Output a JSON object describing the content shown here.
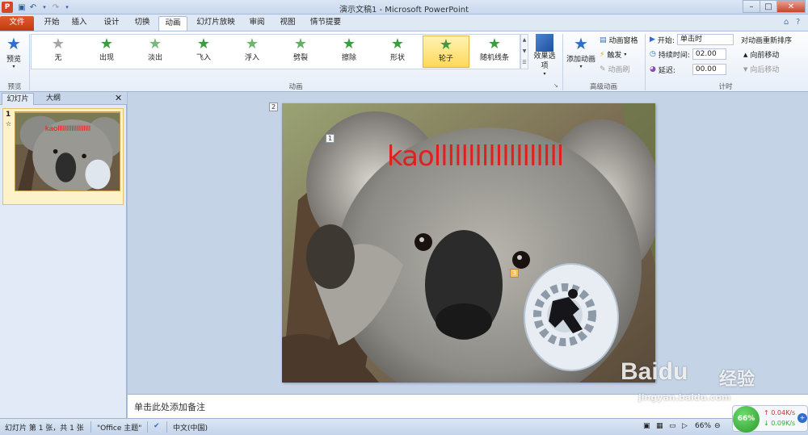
{
  "window": {
    "title": "演示文稿1 - Microsoft PowerPoint",
    "app_logo": "P"
  },
  "tabs": [
    "文件",
    "开始",
    "插入",
    "设计",
    "切换",
    "动画",
    "幻灯片放映",
    "审阅",
    "视图",
    "情节提要"
  ],
  "active_tab": "动画",
  "ribbon": {
    "preview": {
      "label": "预览",
      "group": "预览"
    },
    "animation_group_label": "动画",
    "animations": [
      {
        "label": "无",
        "icon": "star-none-icon",
        "color": "grey"
      },
      {
        "label": "出现",
        "icon": "star-icon",
        "color": "green"
      },
      {
        "label": "淡出",
        "icon": "star-icon",
        "color": "green"
      },
      {
        "label": "飞入",
        "icon": "star-icon",
        "color": "green"
      },
      {
        "label": "浮入",
        "icon": "star-icon",
        "color": "green"
      },
      {
        "label": "劈裂",
        "icon": "star-icon",
        "color": "green"
      },
      {
        "label": "擦除",
        "icon": "star-icon",
        "color": "green"
      },
      {
        "label": "形状",
        "icon": "star-icon",
        "color": "green"
      },
      {
        "label": "轮子",
        "icon": "star-icon",
        "color": "green",
        "selected": true
      },
      {
        "label": "随机线条",
        "icon": "star-icon",
        "color": "green"
      }
    ],
    "effect_options": "效果选项",
    "advanced": {
      "add_animation": "添加动画",
      "animation_pane": "动画窗格",
      "trigger": "触发",
      "painter": "动画刷",
      "group": "高级动画"
    },
    "timing": {
      "start_label": "开始:",
      "start_value": "单击时",
      "duration_label": "持续时间:",
      "duration_value": "02.00",
      "delay_label": "延迟:",
      "delay_value": "00.00",
      "reorder_title": "对动画重新排序",
      "move_earlier": "向前移动",
      "move_later": "向后移动",
      "group": "计时"
    }
  },
  "left_pane": {
    "tabs": [
      "幻灯片",
      "大纲"
    ],
    "slide_number": "1",
    "slide_badge": "☆"
  },
  "slide": {
    "text": "kaolllllllllllllllllll",
    "markers": [
      "1",
      "2",
      "3"
    ]
  },
  "notes_placeholder": "单击此处添加备注",
  "statusbar": {
    "slide_info": "幻灯片 第 1 张，共 1 张",
    "theme": "\"Office 主题\"",
    "language": "中文(中国)",
    "zoom": "66%"
  },
  "watermark": {
    "brand": "Baidu",
    "brand_cn": "经验",
    "url": "jingyan.baidu.com"
  },
  "net_widget": {
    "percent": "66%",
    "up": "0.04K/s",
    "down": "0.09K/s"
  },
  "colors": {
    "accent": "#c43a10",
    "slide_text": "#e02020",
    "selected_anim": "#ffd95a"
  }
}
